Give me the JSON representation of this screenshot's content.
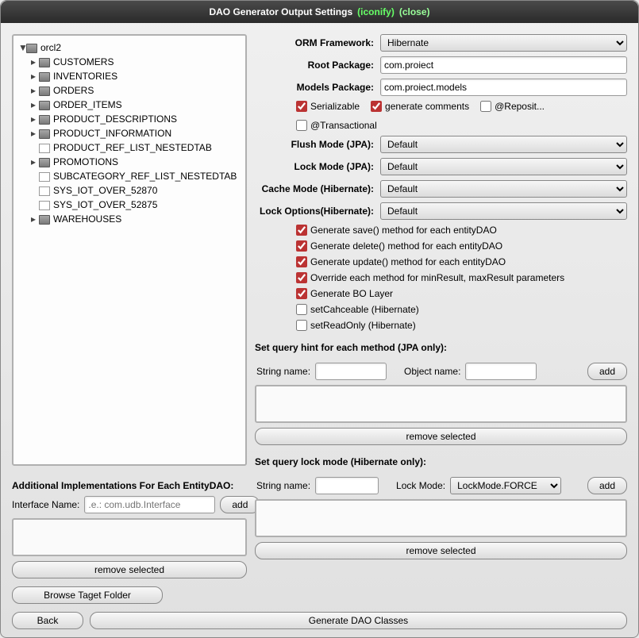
{
  "titlebar": {
    "title": "DAO Generator Output Settings",
    "iconify": "(iconify)",
    "close": "(close)"
  },
  "tree": {
    "root": "orcl2",
    "items": [
      {
        "t": "folder",
        "exp": true,
        "label": "CUSTOMERS"
      },
      {
        "t": "folder",
        "exp": true,
        "label": "INVENTORIES"
      },
      {
        "t": "folder",
        "exp": true,
        "label": "ORDERS"
      },
      {
        "t": "folder",
        "exp": true,
        "label": "ORDER_ITEMS"
      },
      {
        "t": "folder",
        "exp": true,
        "label": "PRODUCT_DESCRIPTIONS"
      },
      {
        "t": "folder",
        "exp": true,
        "label": "PRODUCT_INFORMATION"
      },
      {
        "t": "file",
        "exp": false,
        "label": "PRODUCT_REF_LIST_NESTEDTAB"
      },
      {
        "t": "folder",
        "exp": true,
        "label": "PROMOTIONS"
      },
      {
        "t": "file",
        "exp": false,
        "label": "SUBCATEGORY_REF_LIST_NESTEDTAB"
      },
      {
        "t": "file",
        "exp": false,
        "label": "SYS_IOT_OVER_52870"
      },
      {
        "t": "file",
        "exp": false,
        "label": "SYS_IOT_OVER_52875"
      },
      {
        "t": "folder",
        "exp": true,
        "label": "WAREHOUSES"
      }
    ]
  },
  "addImpl": {
    "heading": "Additional Implementations For Each EntityDAO:",
    "ifaceLabel": "Interface Name:",
    "ifacePlaceholder": ".e.: com.udb.Interface",
    "add": "add",
    "remove": "remove selected",
    "browse": "Browse Taget Folder"
  },
  "form": {
    "orm": {
      "label": "ORM Framework:",
      "value": "Hibernate"
    },
    "rootPkg": {
      "label": "Root Package:",
      "value": "com.proiect"
    },
    "modelsPkg": {
      "label": "Models Package:",
      "value": "com.proiect.models"
    },
    "checks1": {
      "serial": "Serializable",
      "gencom": "generate comments",
      "repo": "@Reposit...",
      "trans": "@Transactional"
    },
    "flush": {
      "label": "Flush Mode (JPA):",
      "value": "Default"
    },
    "lock": {
      "label": "Lock Mode (JPA):",
      "value": "Default"
    },
    "cache": {
      "label": "Cache Mode (Hibernate):",
      "value": "Default"
    },
    "lockOpt": {
      "label": "Lock Options(Hibernate):",
      "value": "Default"
    },
    "gen": [
      {
        "label": "Generate save() method for each entityDAO",
        "checked": true
      },
      {
        "label": "Generate delete() method for each entityDAO",
        "checked": true
      },
      {
        "label": "Generate update() method for each entityDAO",
        "checked": true
      },
      {
        "label": "Override each method for minResult, maxResult parameters",
        "checked": true
      },
      {
        "label": "Generate BO Layer",
        "checked": true
      },
      {
        "label": "setCahceable (Hibernate)",
        "checked": false
      },
      {
        "label": "setReadOnly (Hibernate)",
        "checked": false
      }
    ],
    "hint": {
      "heading": "Set query hint for each method (JPA only):",
      "strName": "String name:",
      "objName": "Object name:",
      "add": "add",
      "remove": "remove selected"
    },
    "qlock": {
      "heading": "Set query lock mode (Hibernate only):",
      "strName": "String name:",
      "lockMode": "Lock Mode:",
      "value": "LockMode.FORCE",
      "add": "add",
      "remove": "remove selected"
    }
  },
  "bottom": {
    "back": "Back",
    "gen": "Generate DAO Classes"
  }
}
